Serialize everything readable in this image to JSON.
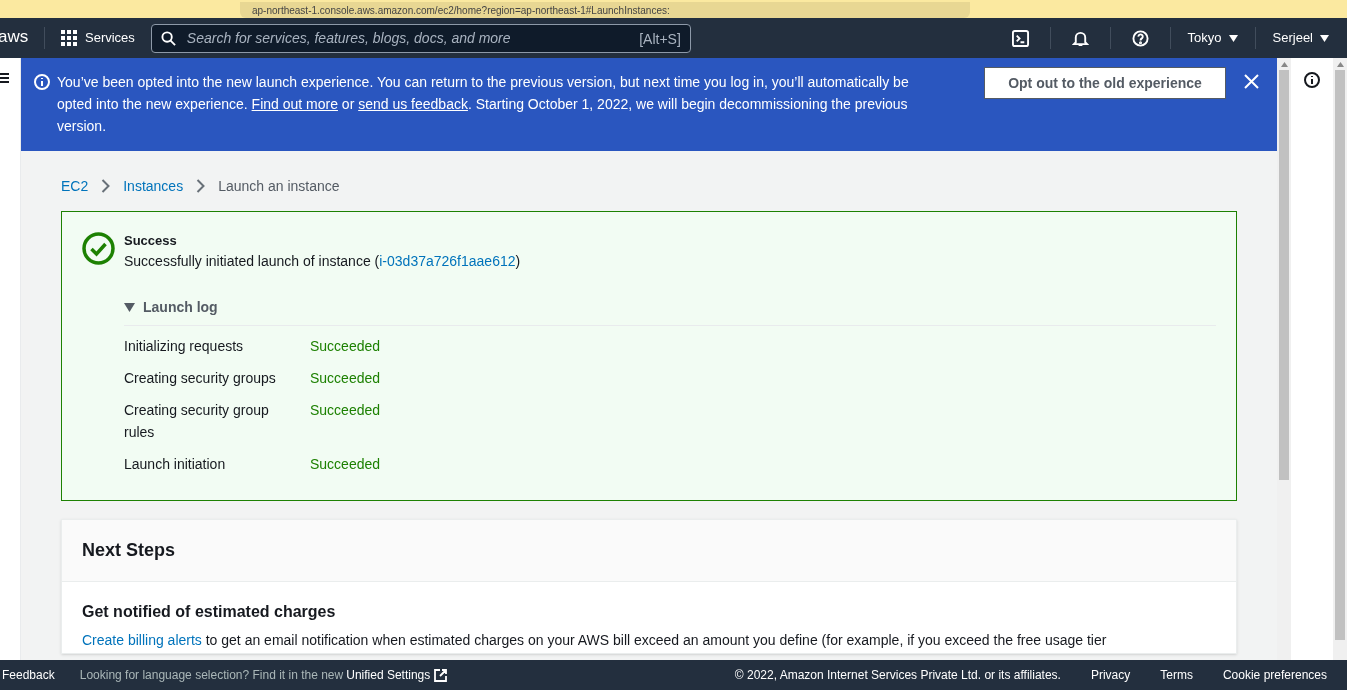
{
  "browser": {
    "url": "ap-northeast-1.console.aws.amazon.com/ec2/home?region=ap-northeast-1#LaunchInstances:"
  },
  "nav": {
    "logo": "aws",
    "services": "Services",
    "search": {
      "placeholder": "Search for services, features, blogs, docs, and more",
      "shortcut": "[Alt+S]"
    },
    "region": "Tokyo",
    "account": "Serjeel"
  },
  "banner": {
    "text_before": "You’ve been opted into the new launch experience. You can return to the previous version, but next time you log in, you’ll automatically be opted into the new experience. ",
    "link_1": "Find out more",
    "text_middle": " or ",
    "link_2": "send us feedback",
    "text_after": ". Starting October 1, 2022, we will begin decommissioning the previous version.",
    "button": "Opt out to the old experience"
  },
  "breadcrumb": [
    {
      "label": "EC2",
      "kind": "link"
    },
    {
      "label": "Instances",
      "kind": "link"
    },
    {
      "label": "Launch an instance",
      "kind": "current"
    }
  ],
  "alert": {
    "title": "Success",
    "message_before": "Successfully initiated launch of instance (",
    "instance_id": "i-03d37a726f1aae612",
    "message_after": ")",
    "log": {
      "title": "Launch log",
      "expanded": true,
      "rows": [
        {
          "step": "Initializing requests",
          "status": "Succeeded"
        },
        {
          "step": "Creating security groups",
          "status": "Succeeded"
        },
        {
          "step": "Creating security group rules",
          "status": "Succeeded"
        },
        {
          "step": "Launch initiation",
          "status": "Succeeded"
        }
      ]
    }
  },
  "next_steps": {
    "title": "Next Steps",
    "sections": [
      {
        "heading": "Get notified of estimated charges",
        "link": "Create billing alerts",
        "text": " to get an email notification when estimated charges on your AWS bill exceed an amount you define (for example, if you exceed the free usage tier"
      }
    ]
  },
  "footer": {
    "feedback": "Feedback",
    "language_prompt": "Looking for language selection? Find it in the new",
    "unified_settings": "Unified Settings",
    "copyright": "© 2022, Amazon Internet Services Private Ltd. or its affiliates.",
    "links": [
      "Privacy",
      "Terms",
      "Cookie preferences"
    ]
  }
}
